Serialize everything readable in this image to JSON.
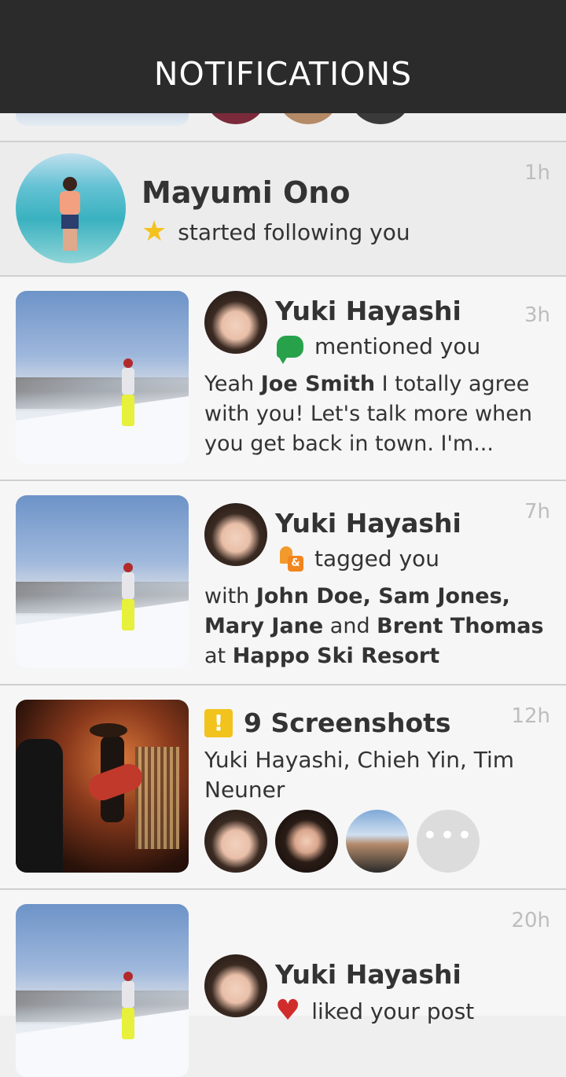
{
  "header": {
    "title": "NOTIFICATIONS"
  },
  "notifications": [
    {
      "type": "follow",
      "name": "Mayumi Ono",
      "action": "started following you",
      "time": "1h",
      "icon": "star-icon"
    },
    {
      "type": "mention",
      "name": "Yuki Hayashi",
      "action": "mentioned you",
      "time": "3h",
      "icon": "chat-bubble-icon",
      "body_pre": "Yeah ",
      "body_bold": "Joe Smith",
      "body_post": " I totally agree with you! Let's talk more when you get back in town. I'm..."
    },
    {
      "type": "tag",
      "name": "Yuki Hayashi",
      "action": "tagged you",
      "time": "7h",
      "icon": "tag-people-icon",
      "with_label": "with ",
      "people_1": "John Doe, Sam Jones,",
      "people_2": "Mary Jane",
      "and_label": " and ",
      "people_3": "Brent Thomas",
      "at_label": "at ",
      "place": "Happo Ski Resort"
    },
    {
      "type": "screenshots",
      "title": "9 Screenshots",
      "time": "12h",
      "icon": "alert-icon",
      "people": "Yuki Hayashi, Chieh Yin, Tim Neuner",
      "more_label": "•••"
    },
    {
      "type": "like",
      "name": "Yuki Hayashi",
      "action": "liked your post",
      "time": "20h",
      "icon": "heart-icon"
    }
  ]
}
